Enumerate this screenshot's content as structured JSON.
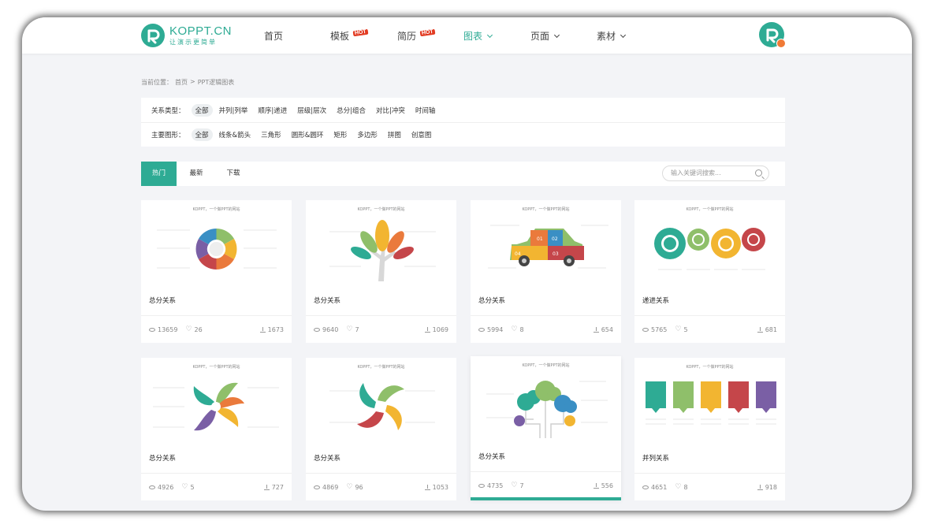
{
  "brand": {
    "name": "KOPPT.CN",
    "slogan": "让演示更简单",
    "accent": "#2eab94"
  },
  "nav": {
    "items": [
      {
        "label": "首页"
      },
      {
        "label": "模板",
        "badge": "HOT"
      },
      {
        "label": "简历",
        "badge": "HOT"
      },
      {
        "label": "图表",
        "dropdown": true,
        "active": true
      },
      {
        "label": "页面",
        "dropdown": true
      },
      {
        "label": "素材",
        "dropdown": true
      }
    ]
  },
  "breadcrumb": {
    "prefix": "当前位置：",
    "home": "首页",
    "sep": ">",
    "current": "PPT逻辑图表"
  },
  "filters": {
    "relation": {
      "label": "关系类型：",
      "options": [
        "全部",
        "并列|列举",
        "顺序|递进",
        "层级|层次",
        "总分|组合",
        "对比|冲突",
        "时间轴"
      ],
      "selected": "全部"
    },
    "shape": {
      "label": "主要图形：",
      "options": [
        "全部",
        "线条&箭头",
        "三角形",
        "圆形&圆环",
        "矩形",
        "多边形",
        "拼图",
        "创意图"
      ],
      "selected": "全部"
    }
  },
  "tabs": {
    "items": [
      "热门",
      "最新",
      "下载"
    ],
    "active": "热门"
  },
  "search": {
    "placeholder": "输入关键词搜索..."
  },
  "thumb_caption": "KOPPT，一个做PPT的网站",
  "cards": [
    {
      "title": "总分关系",
      "views": "13659",
      "likes": "26",
      "downloads": "1673",
      "thumb": "ring"
    },
    {
      "title": "总分关系",
      "views": "9640",
      "likes": "7",
      "downloads": "1069",
      "thumb": "tree"
    },
    {
      "title": "总分关系",
      "views": "5994",
      "likes": "8",
      "downloads": "654",
      "thumb": "car",
      "car_labels": [
        "01",
        "02",
        "03",
        "04"
      ]
    },
    {
      "title": "递进关系",
      "views": "5765",
      "likes": "5",
      "downloads": "681",
      "thumb": "gears"
    },
    {
      "title": "总分关系",
      "views": "4926",
      "likes": "5",
      "downloads": "727",
      "thumb": "pinwheel"
    },
    {
      "title": "总分关系",
      "views": "4869",
      "likes": "96",
      "downloads": "1053",
      "thumb": "pinwheel2"
    },
    {
      "title": "总分关系",
      "views": "4735",
      "likes": "7",
      "downloads": "556",
      "thumb": "cloudtree",
      "hover": true
    },
    {
      "title": "并列关系",
      "views": "4651",
      "likes": "8",
      "downloads": "918",
      "thumb": "boxes"
    }
  ]
}
